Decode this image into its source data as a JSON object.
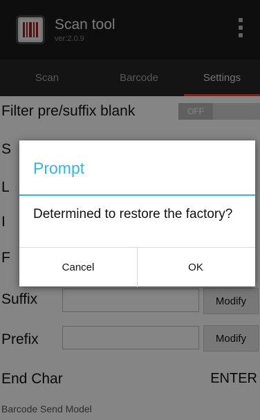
{
  "app": {
    "title": "Scan tool",
    "version": "ver:2.0.9"
  },
  "tabs": [
    {
      "label": "Scan"
    },
    {
      "label": "Barcode"
    },
    {
      "label": "Settings",
      "active": true
    }
  ],
  "settings": {
    "filter_label": "Filter pre/suffix blank",
    "filter_toggle": "OFF",
    "partial_labels": [
      "S",
      "L",
      "I",
      "F"
    ],
    "suffix_label": "Suffix",
    "suffix_button": "Modify",
    "prefix_label": "Prefix",
    "prefix_button": "Modify",
    "end_char_label": "End Char",
    "end_char_value": "ENTER",
    "send_model_label": "Barcode Send Model"
  },
  "dialog": {
    "title": "Prompt",
    "message": "Determined to restore the factory?",
    "cancel_label": "Cancel",
    "ok_label": "OK"
  },
  "colors": {
    "accent": "#33b5e5",
    "tab_indicator": "#e44b3b",
    "titlebar": "#1c1c1c",
    "tabbar": "#272727"
  }
}
